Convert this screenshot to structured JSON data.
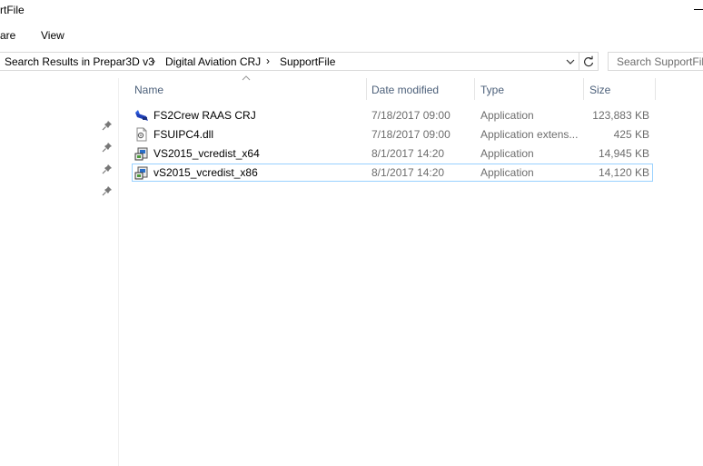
{
  "window": {
    "title": "rtFile"
  },
  "ribbon": {
    "tabs": [
      {
        "label": "are"
      },
      {
        "label": "View"
      }
    ]
  },
  "address": {
    "breadcrumbs": [
      {
        "label": "Search Results in Prepar3D v3"
      },
      {
        "label": "Digital Aviation CRJ"
      },
      {
        "label": "SupportFile"
      }
    ],
    "separator": "›"
  },
  "search": {
    "placeholder": "Search SupportFile"
  },
  "columns": {
    "name": "Name",
    "date": "Date modified",
    "type": "Type",
    "size": "Size"
  },
  "files": [
    {
      "name": "FS2Crew RAAS CRJ",
      "date": "7/18/2017 09:00",
      "type": "Application",
      "size": "123,883 KB",
      "icon": "fs2crew-app-icon"
    },
    {
      "name": "FSUIPC4.dll",
      "date": "7/18/2017 09:00",
      "type": "Application extens...",
      "size": "425 KB",
      "icon": "dll-file-icon"
    },
    {
      "name": "VS2015_vcredist_x64",
      "date": "8/1/2017 14:20",
      "type": "Application",
      "size": "14,945 KB",
      "icon": "installer-icon"
    },
    {
      "name": "vS2015_vcredist_x86",
      "date": "8/1/2017 14:20",
      "type": "Application",
      "size": "14,120 KB",
      "icon": "installer-icon"
    }
  ],
  "selected_row": 3,
  "colors": {
    "header_text": "#4c607a",
    "selection_border": "#99d1ff",
    "secondary_text": "#6d6d6d"
  }
}
